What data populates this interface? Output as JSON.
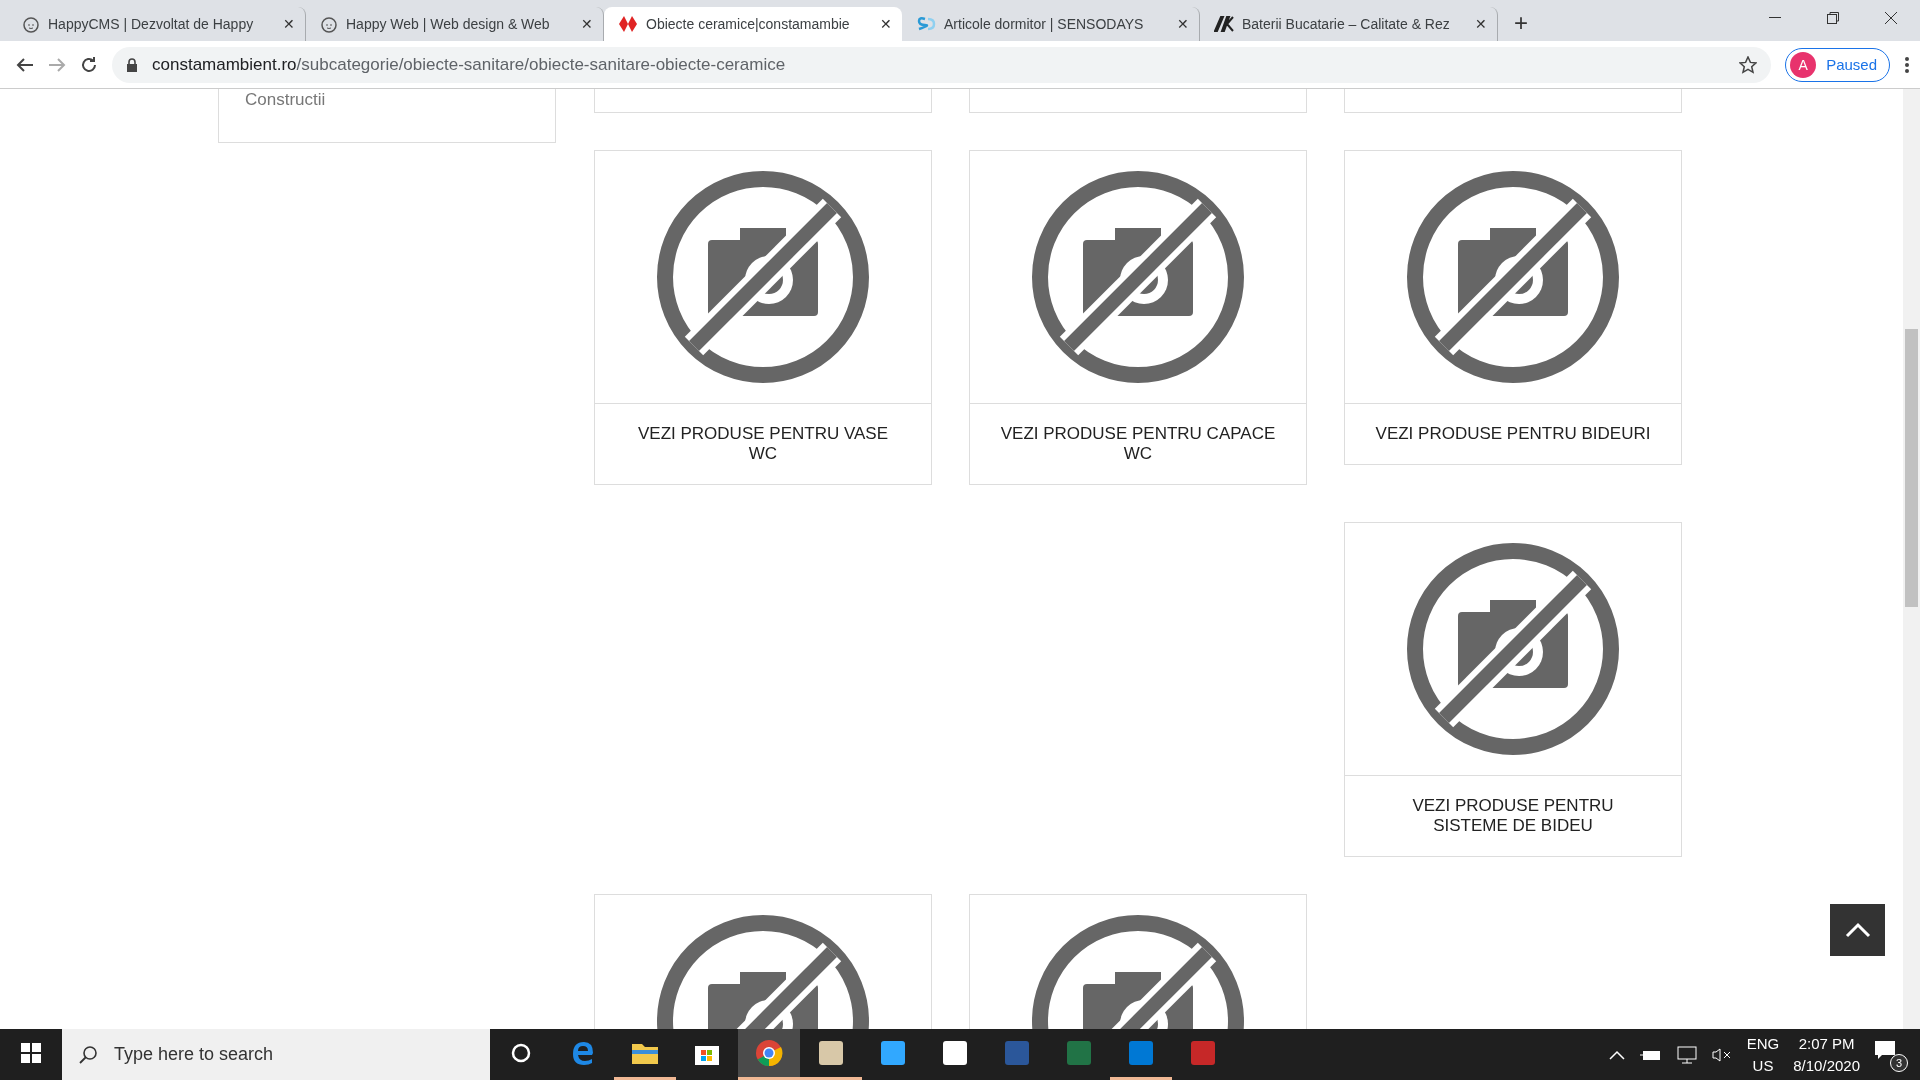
{
  "tabs": [
    {
      "title": "HappyCMS | Dezvoltat de Happy",
      "kind": "face",
      "selected": false,
      "close": "✕"
    },
    {
      "title": "Happy Web | Web design & Web",
      "kind": "face",
      "selected": false,
      "close": "✕"
    },
    {
      "title": "Obiecte ceramice|constamambie",
      "kind": "diamond",
      "selected": true,
      "close": "✕"
    },
    {
      "title": "Articole dormitor | SENSODAYS",
      "kind": "s",
      "selected": false,
      "close": "✕"
    },
    {
      "title": "Baterii Bucatarie – Calitate & Rez",
      "kind": "ak",
      "selected": false,
      "close": "✕"
    }
  ],
  "new_tab": "+",
  "address_bar": {
    "domain": "constamambient.ro",
    "path": "/subcategorie/obiecte-sanitare/obiecte-sanitare-obiecte-ceramice"
  },
  "profile": {
    "initial": "A",
    "status": "Paused"
  },
  "sidebar": {
    "items": [
      "Constructii"
    ]
  },
  "rows": [
    {
      "cells": [
        {
          "kind": "stub"
        },
        {
          "kind": "stub"
        },
        {
          "kind": "stub"
        }
      ]
    },
    {
      "cells": [
        {
          "kind": "card",
          "label": "VEZI PRODUSE PENTRU VASE WC"
        },
        {
          "kind": "card",
          "label": "VEZI PRODUSE PENTRU CAPACE WC"
        },
        {
          "kind": "card",
          "label": "VEZI PRODUSE PENTRU BIDEURI"
        }
      ]
    },
    {
      "cells": [
        {
          "kind": "empty"
        },
        {
          "kind": "empty"
        },
        {
          "kind": "card",
          "label": "VEZI PRODUSE PENTRU SISTEME DE BIDEU"
        }
      ]
    },
    {
      "cells": [
        {
          "kind": "card"
        },
        {
          "kind": "card"
        },
        {
          "kind": "empty"
        }
      ]
    }
  ],
  "taskbar": {
    "search_placeholder": "Type here to search",
    "apps": [
      {
        "kind": "cortana",
        "running": false,
        "selected": false
      },
      {
        "kind": "edge",
        "running": false,
        "selected": false
      },
      {
        "kind": "folder",
        "running": true,
        "selected": false
      },
      {
        "kind": "store",
        "running": false,
        "selected": false
      },
      {
        "kind": "chrome",
        "running": true,
        "selected": true
      },
      {
        "kind": "paint",
        "running": true,
        "selected": false
      },
      {
        "kind": "ps",
        "running": false,
        "selected": false
      },
      {
        "kind": "vsoft",
        "running": false,
        "selected": false
      },
      {
        "kind": "word",
        "running": false,
        "selected": false
      },
      {
        "kind": "excel",
        "running": false,
        "selected": false
      },
      {
        "kind": "outlook",
        "running": true,
        "selected": false
      },
      {
        "kind": "bug",
        "running": false,
        "selected": false
      }
    ],
    "language": "ENG",
    "region": "US",
    "time": "2:07 PM",
    "date": "8/10/2020",
    "notifications": "3"
  }
}
